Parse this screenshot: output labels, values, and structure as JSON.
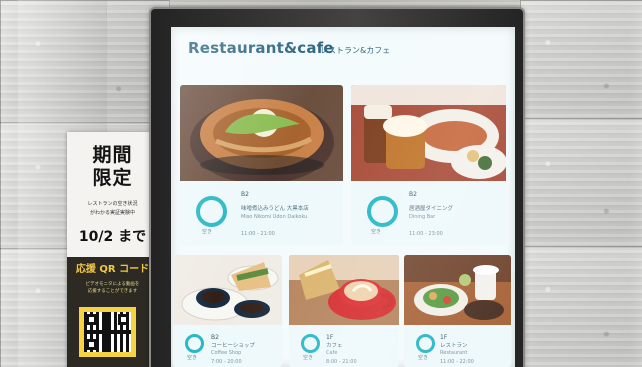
{
  "promo": {
    "title": "期間\n限定",
    "note": "レストランの空き状況\nがわかる実証実験中",
    "date": "10/2 まで",
    "qr_title": "応援 QR コード",
    "qr_note": "ビデオモニタによる動画を\n応援することができます"
  },
  "screen": {
    "title": "Restaurant&cafe",
    "subtitle": "レストラン&カフェ",
    "accent_color": "#26b8c6",
    "title_color": "#2c6480"
  },
  "restaurants": [
    {
      "photo": "miso-nikomi-udon-photo",
      "floor": "B2",
      "name": "味噌煮込みうどん 大黒本店",
      "detail": "Miso Nikomi Udon Daikoku",
      "hours": "11:00 - 21:00",
      "status_label": "空き"
    },
    {
      "photo": "beer-and-plates-photo",
      "floor": "B2",
      "name": "居酒屋ダイニング",
      "detail": "Dining Bar",
      "hours": "11:00 - 23:00",
      "status_label": "空き"
    },
    {
      "photo": "coffee-and-sandwich-photo",
      "floor": "B2",
      "name": "コーヒーショップ",
      "detail": "Coffee Shop",
      "hours": "7:00 - 20:00",
      "status_label": "空き"
    },
    {
      "photo": "latte-and-toast-photo",
      "floor": "1F",
      "name": "カフェ",
      "detail": "Cafe",
      "hours": "8:00 - 21:00",
      "status_label": "空き"
    },
    {
      "photo": "salad-plate-photo",
      "floor": "1F",
      "name": "レストラン",
      "detail": "Restaurant",
      "hours": "11:00 - 22:00",
      "status_label": "空き"
    }
  ]
}
